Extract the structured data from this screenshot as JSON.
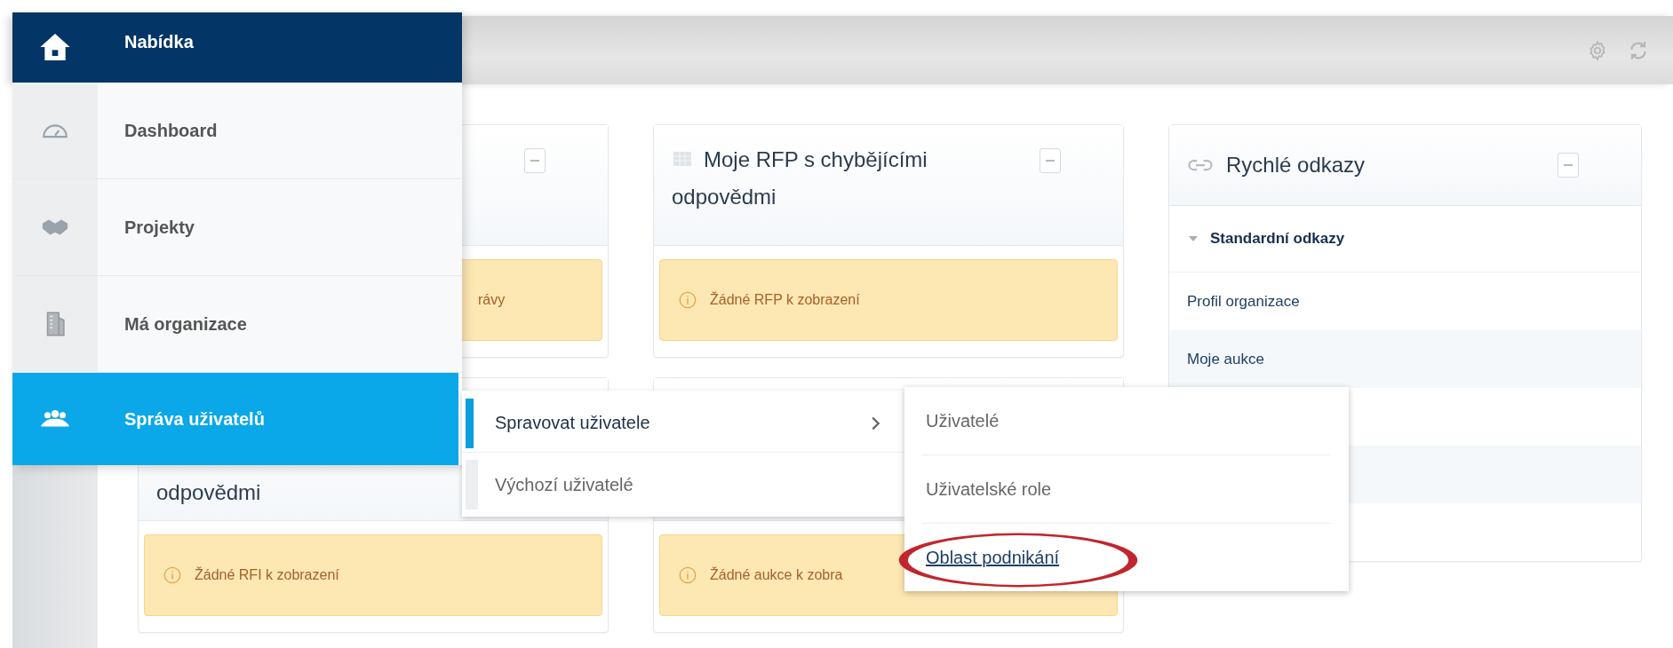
{
  "menu": {
    "title": "Nabídka",
    "items": [
      {
        "label": "Dashboard",
        "selected": false
      },
      {
        "label": "Projekty",
        "selected": false
      },
      {
        "label": "Má organizace",
        "selected": false
      },
      {
        "label": "Správa uživatelů",
        "selected": true
      }
    ]
  },
  "submenu": {
    "items": [
      {
        "label": "Spravovat uživatele",
        "selected": true,
        "has_children": true
      },
      {
        "label": "Výchozí uživatelé",
        "selected": false,
        "has_children": false
      }
    ]
  },
  "submenu_2": {
    "items": [
      {
        "label": "Uživatelé",
        "kind": "item",
        "highlighted": false
      },
      {
        "label": "Uživatelské role",
        "kind": "item",
        "highlighted": false
      },
      {
        "label": "Oblast podnikání",
        "kind": "link",
        "highlighted": true
      }
    ]
  },
  "widget_columns": [
    [
      {
        "alert": "rávy"
      },
      {
        "title": "odpovědmi",
        "alert": "Žádné RFI k zobrazení"
      }
    ],
    [
      {
        "title": "Moje RFP s chybějícími odpovědmi",
        "icon": true,
        "alert": "Žádné RFP k zobrazení"
      },
      {
        "alert": "Žádné aukce k zobra"
      }
    ]
  ],
  "quick_links": {
    "title": "Rychlé odkazy",
    "section": {
      "label": "Standardní odkazy",
      "expanded": true
    },
    "links": [
      "Profil organizace",
      "Moje aukce"
    ]
  }
}
